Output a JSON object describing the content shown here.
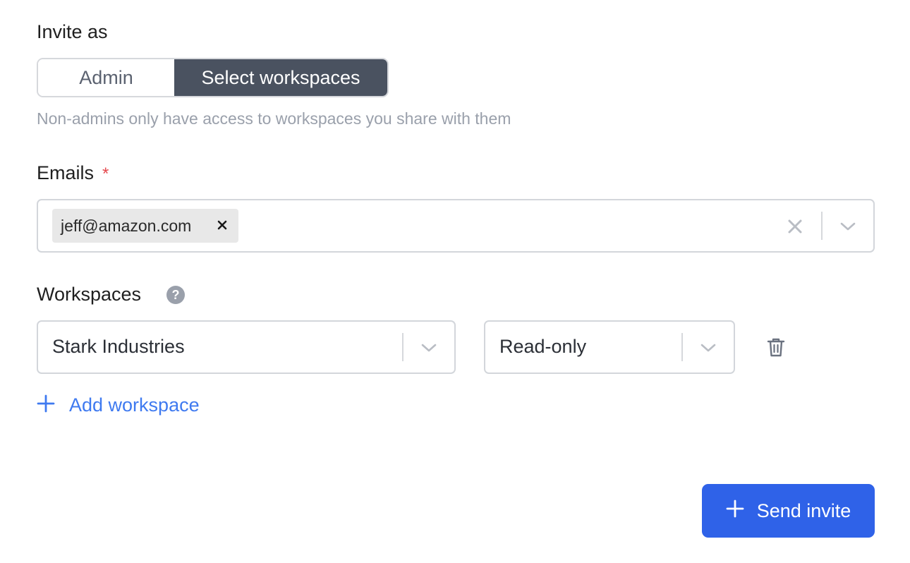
{
  "invite_as": {
    "label": "Invite as",
    "options": [
      "Admin",
      "Select workspaces"
    ],
    "selected": "Select workspaces",
    "hint": "Non-admins only have access to workspaces you share with them"
  },
  "emails": {
    "label": "Emails",
    "required_mark": "*",
    "chips": [
      "jeff@amazon.com"
    ]
  },
  "workspaces": {
    "label": "Workspaces",
    "help_glyph": "?",
    "rows": [
      {
        "workspace": "Stark Industries",
        "permission": "Read-only"
      }
    ],
    "add_label": "Add workspace"
  },
  "actions": {
    "send_label": "Send invite"
  },
  "colors": {
    "active_segment": "#4a5260",
    "primary": "#2f62e8",
    "link": "#3f7af0",
    "required": "#e5484d"
  },
  "icons": {
    "chip_remove": "close-icon",
    "clear": "clear-icon",
    "dropdown": "chevron-down-icon",
    "help": "help-icon",
    "delete": "trash-icon",
    "add": "plus-icon"
  }
}
